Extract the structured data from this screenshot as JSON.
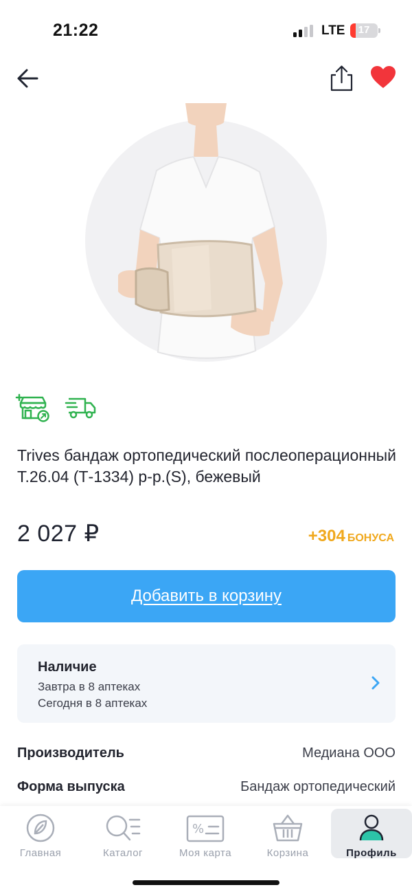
{
  "status_bar": {
    "time": "21:22",
    "network": "LTE",
    "battery": "17"
  },
  "nav": {
    "back_icon": "arrow-left-icon",
    "share_icon": "share-icon",
    "favorite_icon": "heart-icon",
    "favorite_color": "#f2353b"
  },
  "product": {
    "title": "Trives бандаж ортопедический послеоперационный Т.26.04 (Т-1334) р-р.(S), бежевый",
    "price": "2 027 ₽",
    "bonus_value": "+304",
    "bonus_label": "БОНУСА",
    "badges": [
      "pharmacy-pickup-icon",
      "delivery-truck-icon"
    ]
  },
  "cart_button": {
    "label": "Добавить в корзину",
    "color": "#3ba6f5"
  },
  "availability": {
    "title": "Наличие",
    "line1": "Завтра в 8 аптеках",
    "line2": "Сегодня в 8 аптеках"
  },
  "specs": [
    {
      "key": "Производитель",
      "value": "Медиана ООО"
    },
    {
      "key": "Форма выпуска",
      "value": "Бандаж ортопедический"
    }
  ],
  "tabbar": {
    "items": [
      {
        "label": "Главная",
        "icon": "home-logo-icon"
      },
      {
        "label": "Каталог",
        "icon": "catalog-search-icon"
      },
      {
        "label": "Моя карта",
        "icon": "discount-card-icon"
      },
      {
        "label": "Корзина",
        "icon": "basket-icon"
      },
      {
        "label": "Профиль",
        "icon": "profile-icon"
      }
    ],
    "active": "Профиль"
  },
  "colors": {
    "accent": "#3ba6f5",
    "bonus": "#f0a81c",
    "badge_green": "#2fb24f"
  }
}
